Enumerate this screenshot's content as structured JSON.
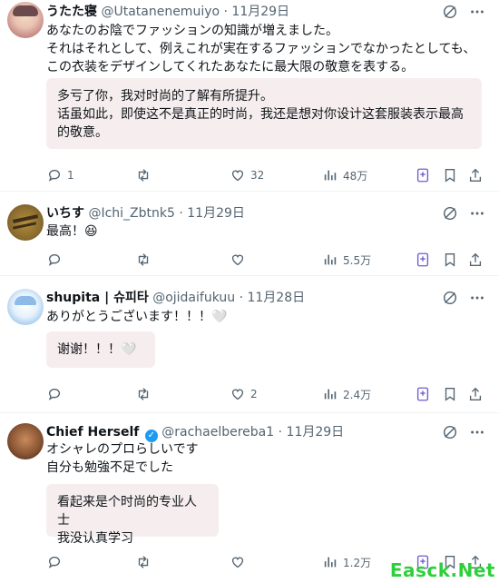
{
  "tweets": [
    {
      "name": "うたた寝",
      "handle": "@Utatanenemuiyo",
      "sep": "·",
      "date": "11月29日",
      "text": "あなたのお陰でファッションの知識が増えました。\nそれはそれとして、例えこれが実在するファッションでなかったとしても、\nこの衣装をデザインしてくれたあなたに最大限の敬意を表する。",
      "translation": "多亏了你，我对时尚的了解有所提升。\n话虽如此，即使这不是真正的时尚，我还是想对你设计这套服装表示最高\n的敬意。",
      "replies": "1",
      "retweets": "",
      "likes": "32",
      "views": "48万"
    },
    {
      "name": "いちす",
      "handle": "@Ichi_Zbtnk5",
      "sep": "·",
      "date": "11月29日",
      "text": "最高！😆",
      "translation": "",
      "replies": "",
      "retweets": "",
      "likes": "",
      "views": "5.5万"
    },
    {
      "name": "shupita | 슈피타",
      "handle": "@ojidaifukuu",
      "sep": "·",
      "date": "11月28日",
      "text": "ありがとうございます！！！🤍",
      "translation": "谢谢！！！🤍",
      "replies": "",
      "retweets": "",
      "likes": "2",
      "views": "2.4万"
    },
    {
      "name": "Chief Herself",
      "handle": "@rachaelbereba1",
      "sep": "·",
      "date": "11月29日",
      "text": "オシャレのプロらしいです\n自分も勉強不足でした",
      "translation": "看起来是个时尚的专业人士\n我没认真学习",
      "replies": "",
      "retweets": "",
      "likes": "",
      "views": "1.2万"
    }
  ],
  "watermark": "Easck.Net",
  "colors": {
    "muted": "#536471",
    "translation_bg": "#f6eeee",
    "verified": "#1d9bf0",
    "watermark": "#2fcf3c"
  }
}
